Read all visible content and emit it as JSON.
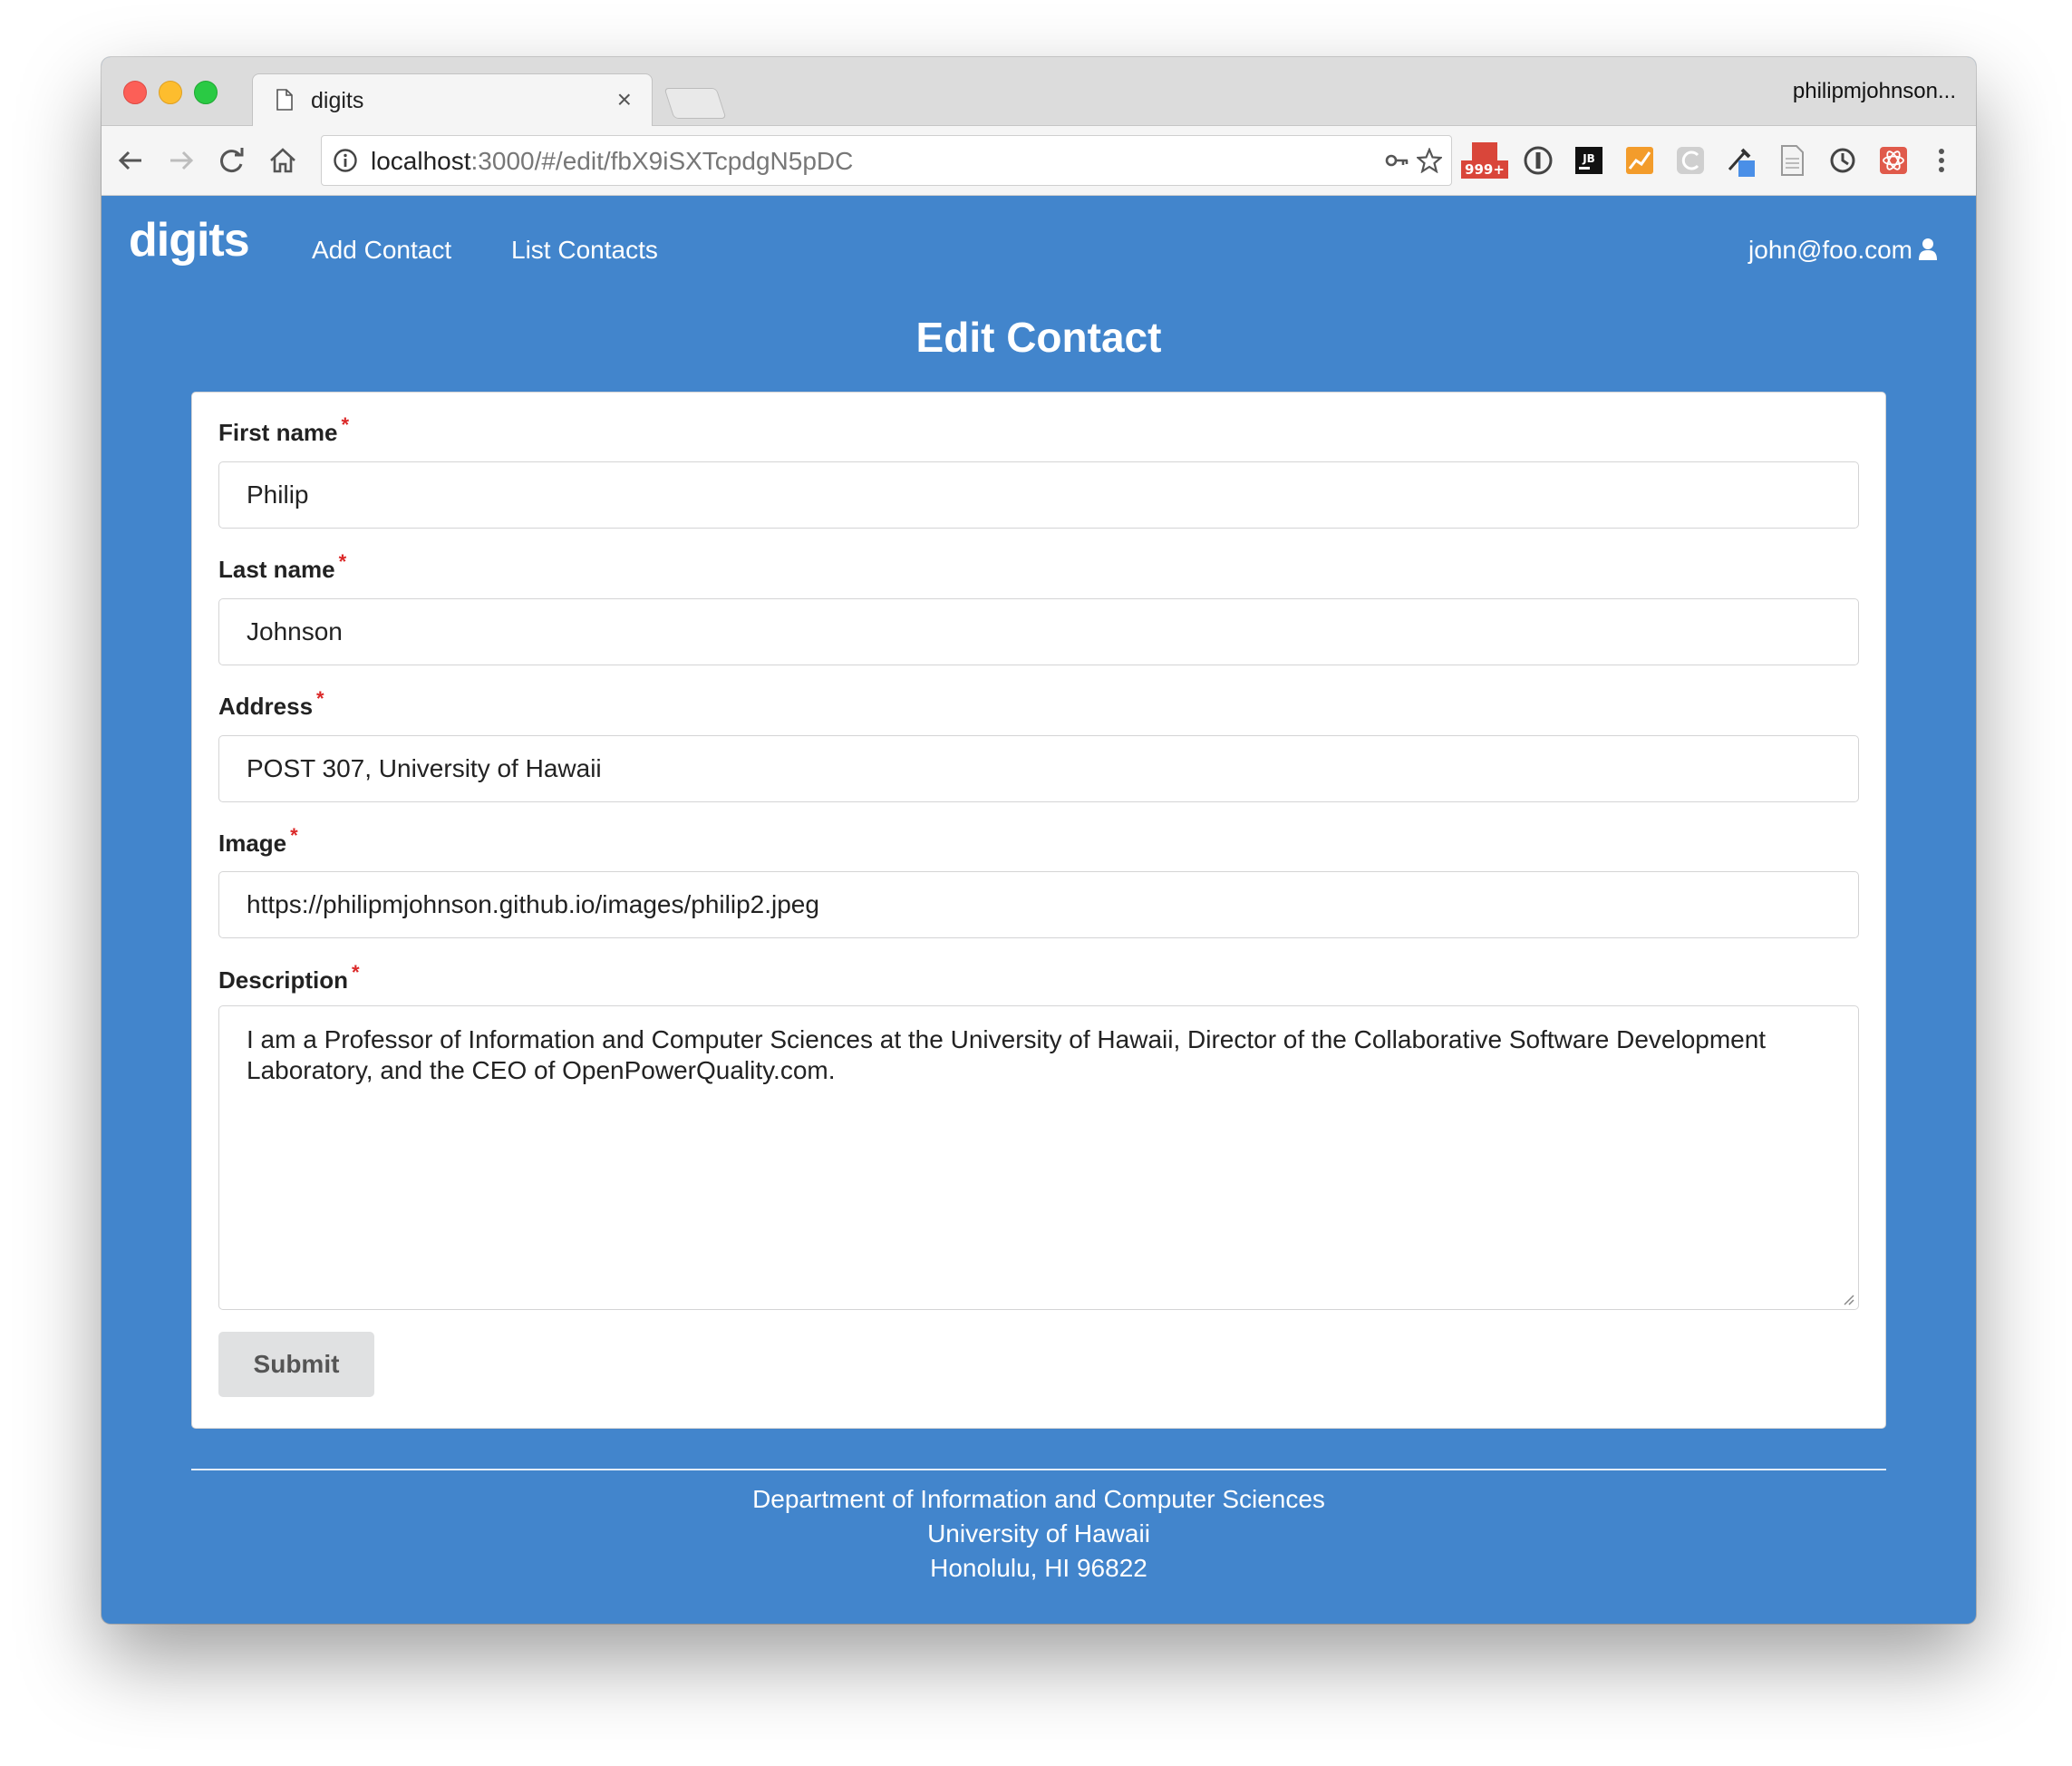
{
  "browser": {
    "tab_title": "digits",
    "tab_close": "×",
    "profile_name": "philipmjohnson...",
    "url_host": "localhost",
    "url_rest": ":3000/#/edit/fbX9iSXTcpdgN5pDC",
    "extension_badge": "999+",
    "extension_jb_label": "JB"
  },
  "navbar": {
    "brand": "digits",
    "links": [
      "Add Contact",
      "List Contacts"
    ],
    "user_email": "john@foo.com"
  },
  "page": {
    "title": "Edit Contact"
  },
  "form": {
    "required_mark": "*",
    "fields": [
      {
        "label": "First name",
        "value": "Philip"
      },
      {
        "label": "Last name",
        "value": "Johnson"
      },
      {
        "label": "Address",
        "value": "POST 307, University of Hawaii"
      },
      {
        "label": "Image",
        "value": "https://philipmjohnson.github.io/images/philip2.jpeg"
      }
    ],
    "description": {
      "label": "Description",
      "value": "I am a Professor of Information and Computer Sciences at the University of Hawaii, Director of the Collaborative Software Development Laboratory, and the CEO of OpenPowerQuality.com."
    },
    "submit_label": "Submit"
  },
  "footer": {
    "lines": [
      "Department of Information and Computer Sciences",
      "University of Hawaii",
      "Honolulu, HI 96822"
    ]
  },
  "colors": {
    "page_background": "#4285cc",
    "required": "#db2828",
    "button": "#e0e1e2"
  }
}
